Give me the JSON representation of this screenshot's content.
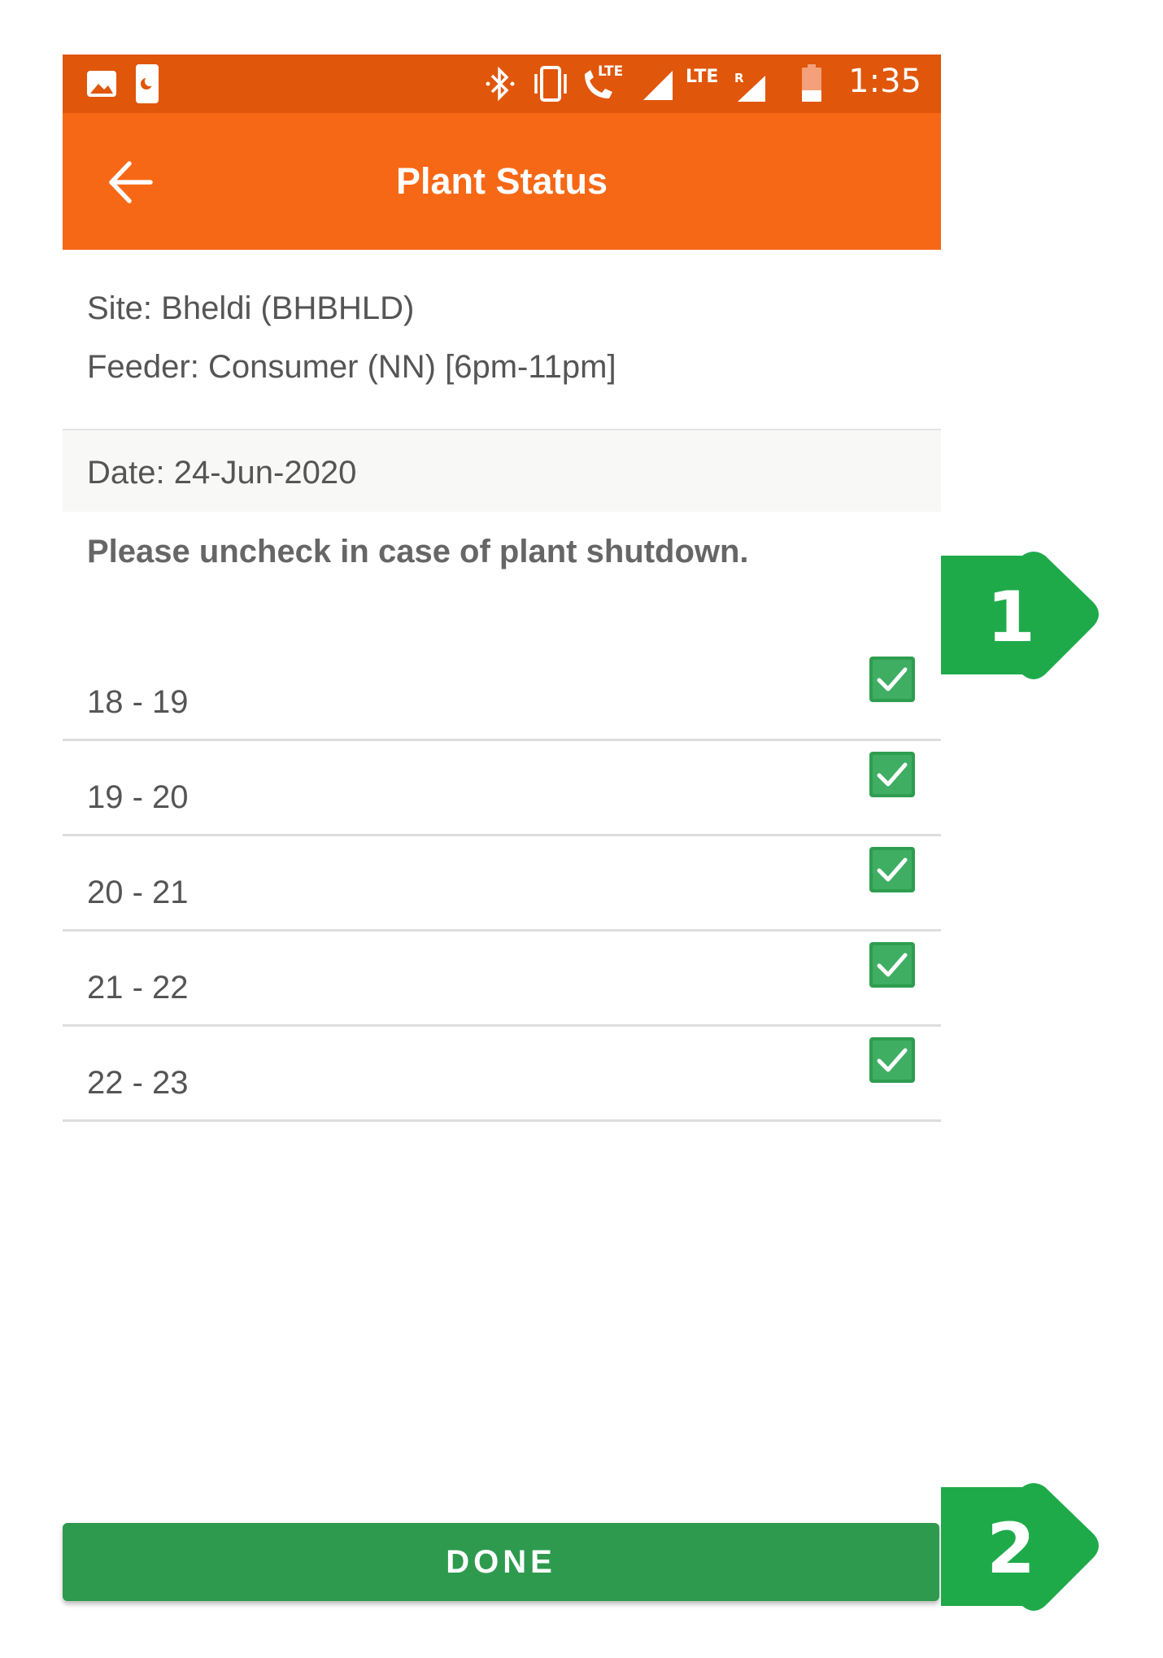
{
  "status_bar": {
    "time": "1:35",
    "icons": [
      "image-icon",
      "moon-sim-icon",
      "bluetooth-icon",
      "vibrate-icon",
      "volte-call-icon",
      "signal-icon",
      "lte-roaming-signal-icon",
      "battery-icon"
    ],
    "lte_label": "LTE",
    "roaming_label": "R"
  },
  "app_bar": {
    "title": "Plant Status",
    "back_icon": "arrow-left-icon",
    "color": "#f76816"
  },
  "info": {
    "site": "Site: Bheldi (BHBHLD)",
    "feeder": "Feeder: Consumer (NN) [6pm-11pm]",
    "date": "Date: 24-Jun-2020"
  },
  "instruction": "Please uncheck in case of plant shutdown.",
  "slots": [
    {
      "label": "18 - 19",
      "checked": true
    },
    {
      "label": "19 - 20",
      "checked": true
    },
    {
      "label": "20 - 21",
      "checked": true
    },
    {
      "label": "21 - 22",
      "checked": true
    },
    {
      "label": "22 - 23",
      "checked": true
    }
  ],
  "done_button": {
    "label": "DONE",
    "color": "#2e9a4e"
  },
  "callouts": [
    {
      "number": "1",
      "color": "#1faa4a"
    },
    {
      "number": "2",
      "color": "#1faa4a"
    }
  ]
}
